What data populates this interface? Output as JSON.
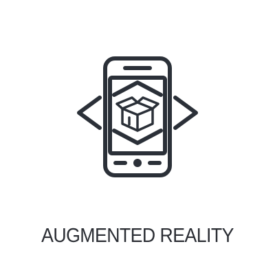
{
  "caption": {
    "text": "AUGMENTED REALITY"
  },
  "icon": {
    "name": "augmented-reality-phone-icon",
    "stroke_color": "#2b3038"
  },
  "background_color": "#ffffff"
}
